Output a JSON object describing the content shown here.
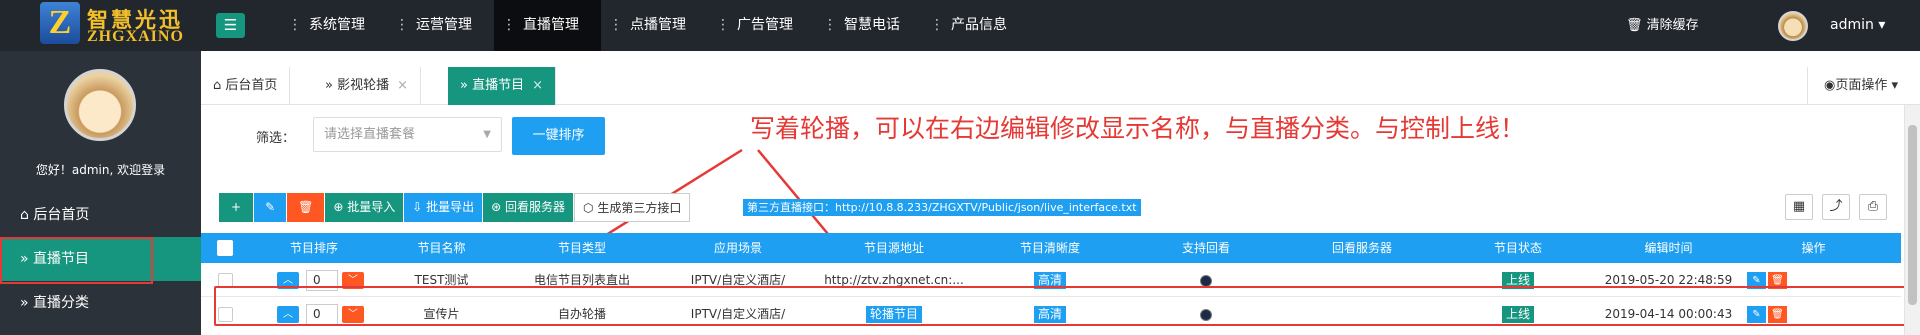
{
  "logo": {
    "letter": "Z",
    "cn": "智慧光迅",
    "en": "ZHGXAINO"
  },
  "topnav": [
    {
      "label": "系统管理"
    },
    {
      "label": "运营管理"
    },
    {
      "label": "直播管理"
    },
    {
      "label": "点播管理"
    },
    {
      "label": "广告管理"
    },
    {
      "label": "智慧电话"
    },
    {
      "label": "产品信息"
    }
  ],
  "header": {
    "clear_cache": "清除缓存",
    "user": "admin"
  },
  "sidebar": {
    "welcome": "您好！admin, 欢迎登录",
    "items": [
      {
        "label": "后台首页"
      },
      {
        "label": "直播节目"
      },
      {
        "label": "直播分类"
      }
    ]
  },
  "tabs": [
    {
      "label": "后台首页"
    },
    {
      "label": "影视轮播"
    },
    {
      "label": "直播节目"
    }
  ],
  "page_op": "页面操作",
  "filter": {
    "label": "筛选：",
    "placeholder": "请选择直播套餐",
    "sort_button": "一键排序"
  },
  "annotation": "写着轮播，可以在右边编辑修改显示名称，与直播分类。与控制上线！",
  "toolbar": {
    "add": "+",
    "batch_import": "批量导入",
    "batch_export": "批量导出",
    "replay_server": "回看服务器",
    "gen_third_party": "生成第三方接口",
    "api_badge": "第三方直播接口：http://10.8.8.233/ZHGXTV/Public/json/live_interface.txt"
  },
  "table": {
    "headers": [
      "节目排序",
      "节目名称",
      "节目类型",
      "应用场景",
      "节目源地址",
      "节目清晰度",
      "支持回看",
      "回看服务器",
      "节目状态",
      "编辑时间",
      "操作"
    ],
    "rows": [
      {
        "order": "0",
        "name": "TEST测试",
        "type": "电信节目列表直出",
        "scene": "IPTV/自定义酒店/",
        "source": "http://ztv.zhgxnet.cn:...",
        "quality": "高清",
        "replay_server": "",
        "status": "上线",
        "edit_time": "2019-05-20 22:48:59"
      },
      {
        "order": "0",
        "name": "宣传片",
        "type": "自办轮播",
        "scene": "IPTV/自定义酒店/",
        "source": "轮播节目",
        "quality": "高清",
        "replay_server": "",
        "status": "上线",
        "edit_time": "2019-04-14 00:00:43"
      }
    ]
  },
  "colors": {
    "teal": "#16967f",
    "blue": "#1e9ff2",
    "orange": "#ff5722",
    "dark": "#22262d",
    "annotation_red": "#e53935"
  }
}
